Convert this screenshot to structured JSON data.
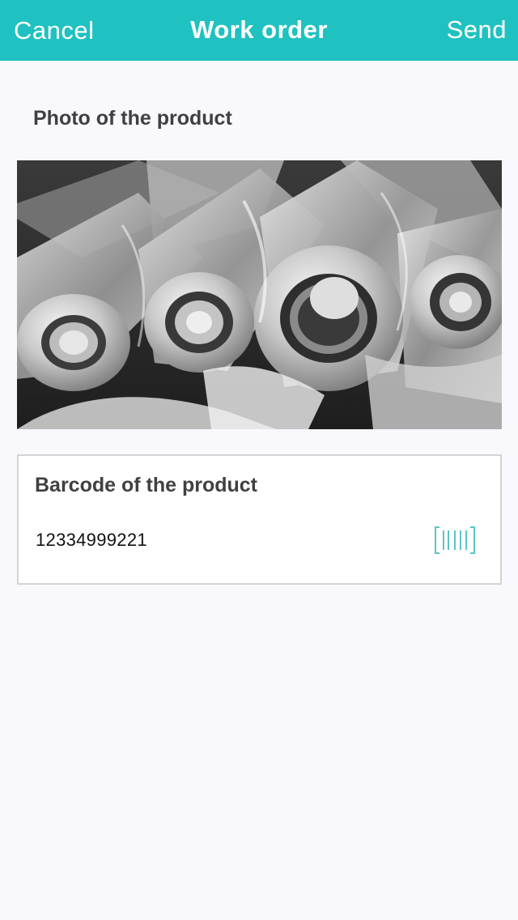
{
  "nav": {
    "cancel_label": "Cancel",
    "title": "Work order",
    "send_label": "Send",
    "background_color": "#1fc2c0"
  },
  "photo_section": {
    "label": "Photo of the product"
  },
  "barcode_section": {
    "label": "Barcode of the product",
    "value": "12334999221",
    "scan_icon": "barcode-scan-icon",
    "icon_color": "#5cc5c3"
  }
}
